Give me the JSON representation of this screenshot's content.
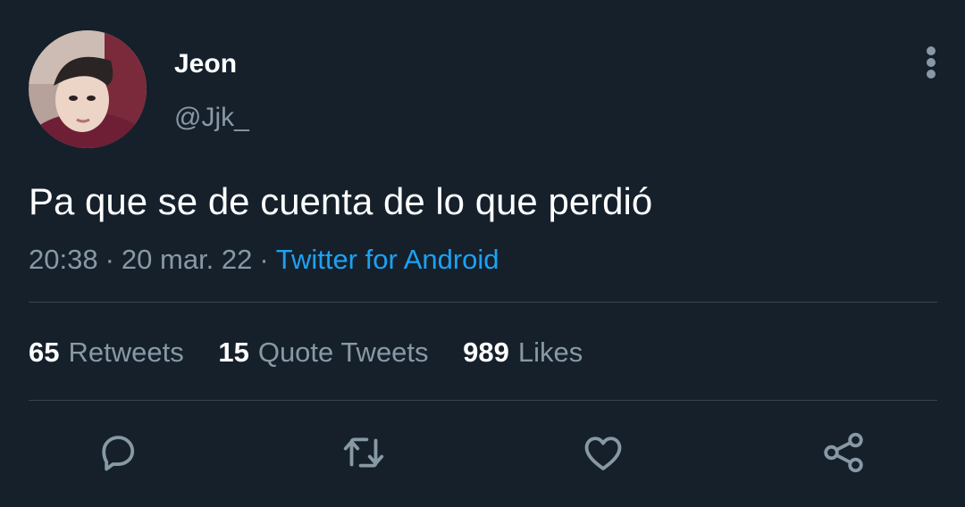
{
  "author": {
    "display_name": "Jeon",
    "handle": "@Jjk_"
  },
  "tweet": {
    "text": "Pa que se de cuenta de lo que perdió",
    "time": "20:38",
    "separator": "·",
    "date": "20 mar. 22",
    "source": "Twitter for Android"
  },
  "stats": {
    "retweets_count": "65",
    "retweets_label": "Retweets",
    "quotes_count": "15",
    "quotes_label": "Quote Tweets",
    "likes_count": "989",
    "likes_label": "Likes"
  },
  "actions": [
    "reply-icon",
    "retweet-icon",
    "like-icon",
    "share-icon"
  ],
  "colors": {
    "background": "#15202b",
    "text_primary": "#ffffff",
    "text_secondary": "#8899a6",
    "link": "#1da1f2",
    "divider": "#38444d"
  }
}
